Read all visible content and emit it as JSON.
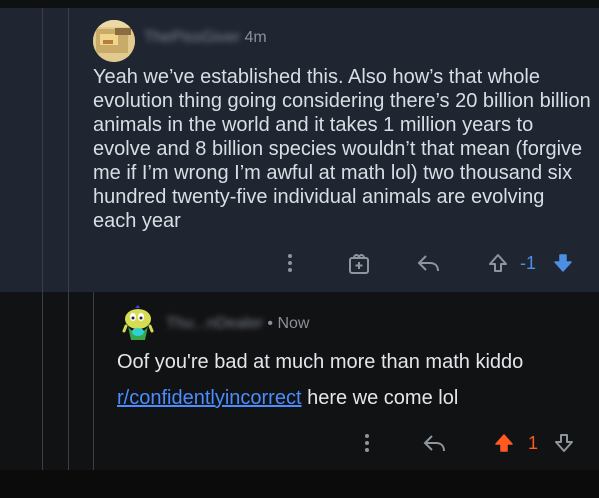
{
  "comment_1": {
    "username": "ThePissGiver",
    "time": "4m",
    "body": "Yeah we’ve established this. Also how’s that whole evolution thing going considering there’s 20 billion billion animals in the world and it takes 1 million years to evolve and 8 billion species wouldn’t that mean (forgive me if I’m wrong I’m awful at math lol) two thousand six hundred twenty-five individual animals are evolving each year",
    "score": "-1",
    "icons": [
      "more-icon",
      "award-icon",
      "reply-icon",
      "upvote-icon",
      "downvote-icon"
    ],
    "vote_color": "#4e8fe6"
  },
  "comment_2": {
    "username": "Thu...nDealer",
    "separator": "•",
    "time": "Now",
    "body": "Oof you're bad at much more than math kiddo",
    "link_text": "r/confidentlyincorrect",
    "after_link": " here we come lol",
    "score": "1",
    "icons": [
      "more-icon",
      "reply-icon",
      "upvote-icon",
      "downvote-icon"
    ],
    "vote_color": "#ff5a1f"
  }
}
